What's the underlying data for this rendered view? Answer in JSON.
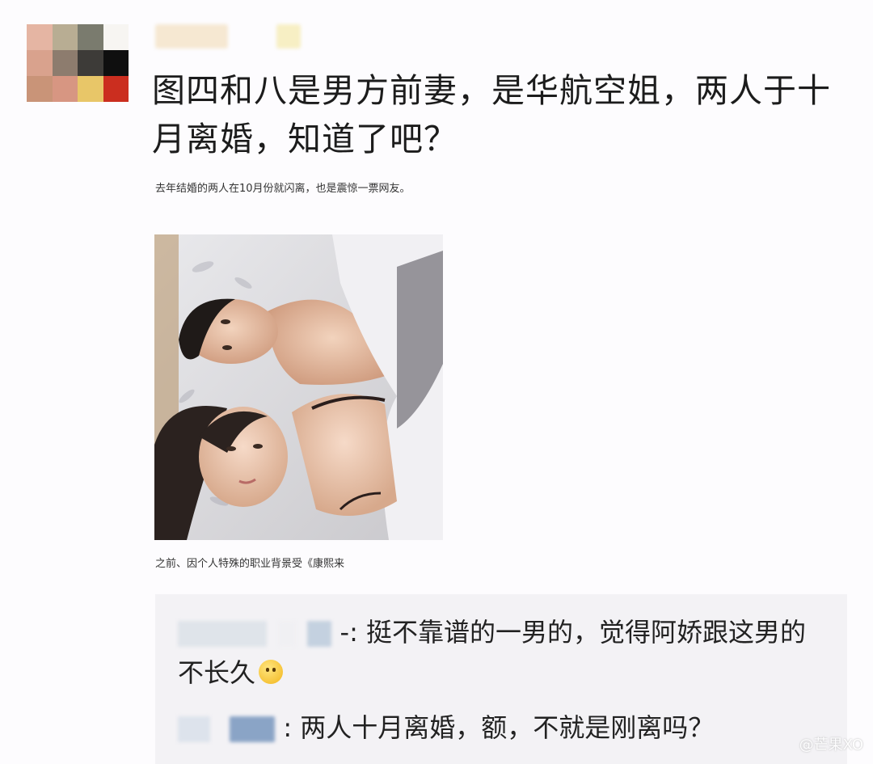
{
  "post": {
    "text": "图四和八是男方前妻，是华航空姐，两人于十月离婚，知道了吧？",
    "caption_top": "去年结婚的两人在10月份就闪离，也是震惊一票网友。",
    "caption_bottom": "之前、因个人特殊的职业背景受《康熙来"
  },
  "comments": [
    {
      "name_suffix": "-",
      "text": ": 挺不靠谱的一男的，觉得阿娇跟这男的不长久",
      "emoji": "upside-down-face-icon"
    },
    {
      "name_suffix": "",
      "text": ": 两人十月离婚，额，不就是刚离吗？"
    }
  ],
  "watermark": "@芒果XO",
  "colors": {
    "background": "#fdfcfe",
    "comment_bg": "#f3f2f5",
    "text": "#1c1c1c"
  }
}
